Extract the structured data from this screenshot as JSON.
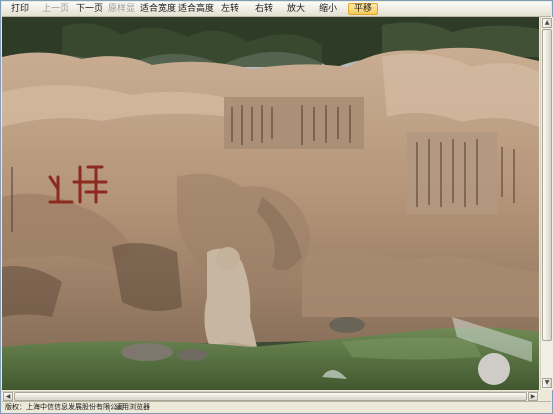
{
  "toolbar": {
    "buttons": [
      {
        "label": "打印",
        "state": "normal"
      },
      {
        "label": "上一页",
        "state": "disabled"
      },
      {
        "label": "下一页",
        "state": "normal"
      },
      {
        "label": "原样显",
        "state": "disabled"
      },
      {
        "label": "适合宽度",
        "state": "normal"
      },
      {
        "label": "适合高度",
        "state": "normal"
      },
      {
        "label": "左转",
        "state": "normal"
      },
      {
        "label": "右转",
        "state": "normal"
      },
      {
        "label": "放大",
        "state": "normal"
      },
      {
        "label": "缩小",
        "state": "normal"
      },
      {
        "label": "平移",
        "state": "active"
      }
    ]
  },
  "image": {
    "subject": "rock-carving-photo-icon"
  },
  "statusbar": {
    "copyright": "版权：上海中信信息发展股份有限公司",
    "browser": "通用浏览器"
  },
  "colors": {
    "toolbar_bg": "#e3e0d0",
    "active_tool": "#f7c95a",
    "frame_border": "#7f9db9"
  }
}
